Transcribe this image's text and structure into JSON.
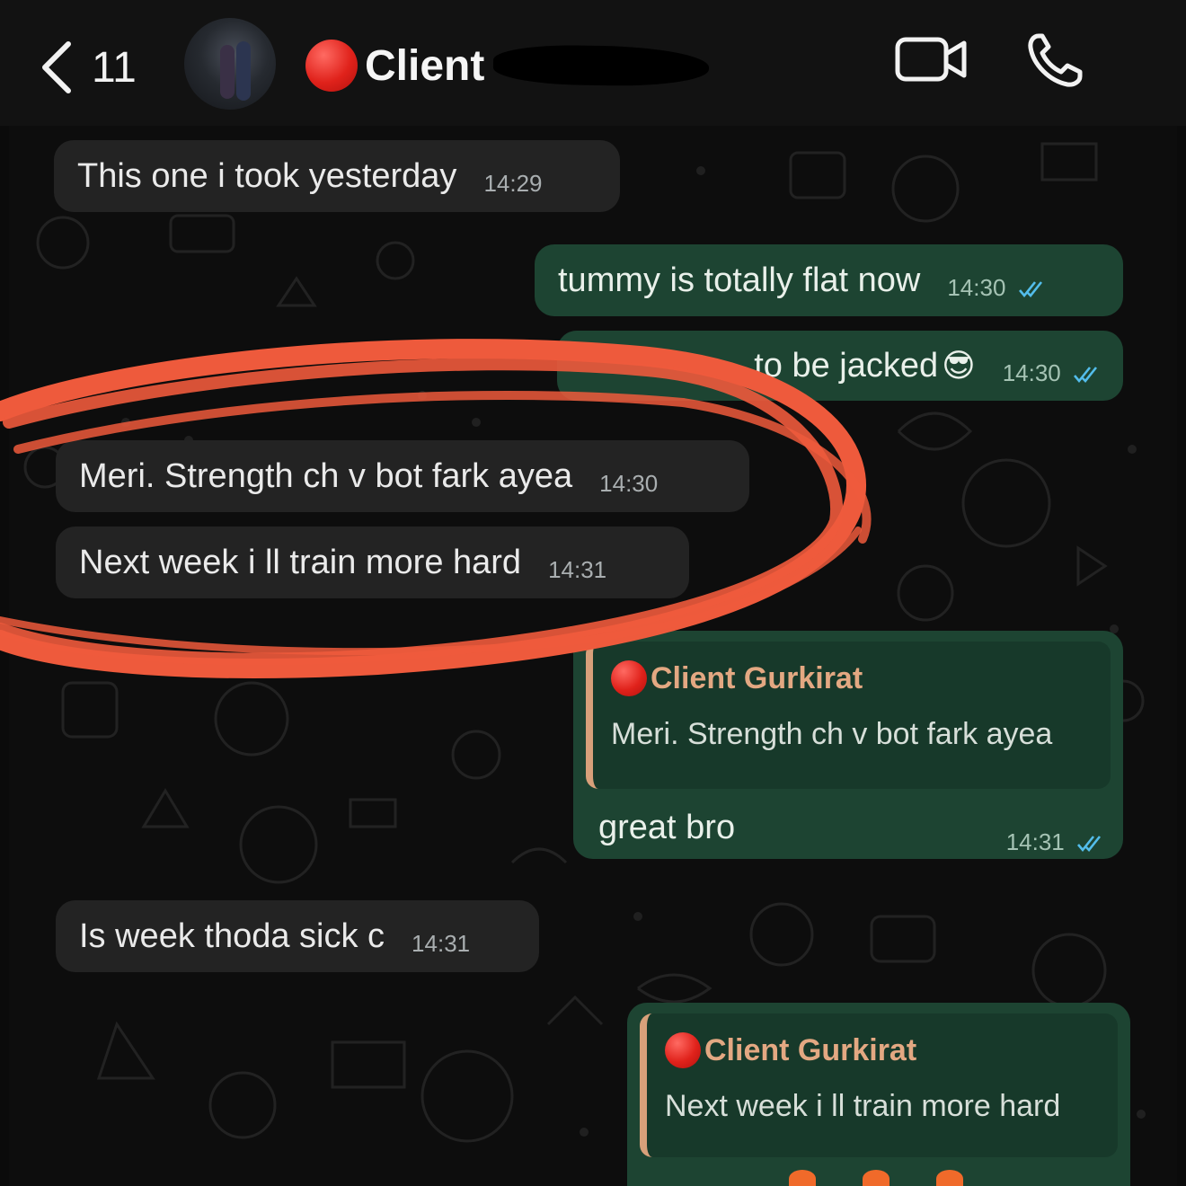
{
  "header": {
    "back_count": "11",
    "contact_name": "Client",
    "colors": {
      "background": "#121212",
      "status_dot": "#e0221b"
    }
  },
  "messages": [
    {
      "direction": "incoming",
      "text": "This one i took yesterday",
      "time": "14:29"
    },
    {
      "direction": "outgoing",
      "text": "tummy is totally flat now",
      "time": "14:30",
      "status": "read"
    },
    {
      "direction": "outgoing",
      "text": "to be jacked",
      "emoji": "😎",
      "time": "14:30",
      "status": "read"
    },
    {
      "direction": "incoming",
      "text": "Meri. Strength ch v bot fark ayea",
      "time": "14:30"
    },
    {
      "direction": "incoming",
      "text": "Next week i ll train more hard",
      "time": "14:31"
    },
    {
      "direction": "outgoing",
      "quote": {
        "author": "Client Gurkirat",
        "text": "Meri. Strength ch v bot fark ayea"
      },
      "text": "great bro",
      "time": "14:31",
      "status": "read"
    },
    {
      "direction": "incoming",
      "text": "Is week thoda sick c",
      "time": "14:31"
    },
    {
      "direction": "outgoing",
      "quote": {
        "author": "Client Gurkirat",
        "text": "Next week i ll train more hard"
      }
    }
  ],
  "icons": [
    "chevron-left-icon",
    "video-camera-icon",
    "phone-icon",
    "double-check-icon",
    "red-circle-emoji"
  ],
  "colors": {
    "incoming_bubble": "#232323",
    "outgoing_bubble": "#1d4432",
    "quote_accent": "#d8a07a",
    "quote_author": "#e3a882",
    "read_ticks": "#53bdeb",
    "annotation": "#ee5a3c"
  }
}
